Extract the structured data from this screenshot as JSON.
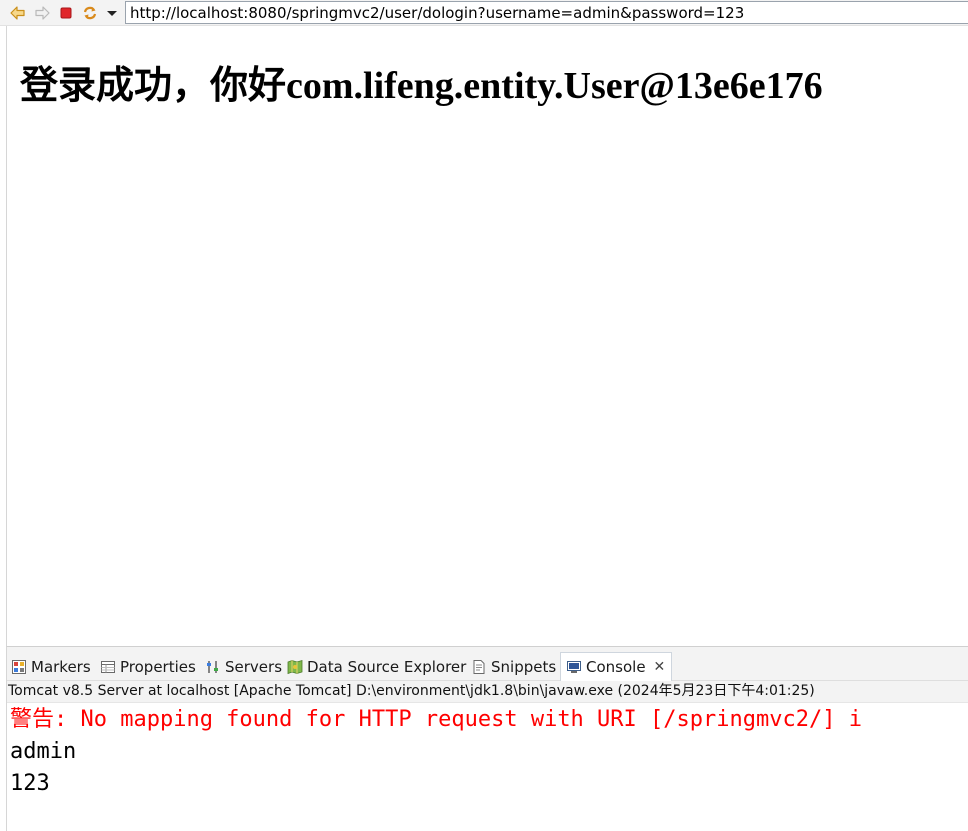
{
  "browser": {
    "url": "http://localhost:8080/springmvc2/user/dologin?username=admin&password=123",
    "buttons": [
      "back-icon",
      "forward-icon",
      "stop-icon",
      "refresh-icon",
      "dropdown-icon"
    ]
  },
  "page": {
    "heading": "登录成功，你好com.lifeng.entity.User@13e6e176"
  },
  "views": {
    "tabs": [
      {
        "label": "Markers",
        "icon": "markers-icon"
      },
      {
        "label": "Properties",
        "icon": "properties-icon"
      },
      {
        "label": "Servers",
        "icon": "servers-icon"
      },
      {
        "label": "Data Source Explorer",
        "icon": "data-source-icon"
      },
      {
        "label": "Snippets",
        "icon": "snippets-icon"
      },
      {
        "label": "Console",
        "icon": "console-icon",
        "active": true
      }
    ],
    "console_info": "Tomcat v8.5 Server at localhost [Apache Tomcat] D:\\environment\\jdk1.8\\bin\\javaw.exe  (2024年5月23日下午4:01:25)",
    "console_lines": [
      "警告: No mapping found for HTTP request with URI [/springmvc2/] i",
      "admin",
      "123"
    ]
  },
  "colors": {
    "warning_text": "#ff0000",
    "toolbar_bg": "#f3f3f3"
  }
}
